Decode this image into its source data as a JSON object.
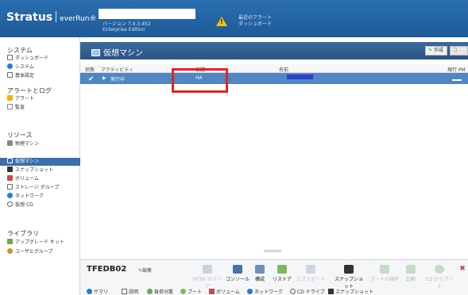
{
  "header": {
    "logo": "Stratus",
    "logo_sub": "everRun®",
    "version_line1": "バージョン 7.4.3-452",
    "version_line2": "Enterprise Edition",
    "alert_line1": "最近のアラート",
    "alert_line2": "ダッシュボード"
  },
  "sidebar": {
    "system_title": "システム",
    "system_items": [
      "ダッシュボード",
      "システム",
      "基本設定"
    ],
    "alerts_title": "アラートとログ",
    "alerts_items": [
      "アラート",
      "監査"
    ],
    "resources_title": "リソース",
    "resources_items": [
      "物理マシン",
      "仮想マシン",
      "スナップショット",
      "ボリューム",
      "ストレージ グループ",
      "ネットワーク",
      "仮想 CD"
    ],
    "library_title": "ライブラリ",
    "library_items": [
      "アップグレード キット",
      "ユーザとグループ"
    ]
  },
  "panel": {
    "title": "仮想マシン",
    "create_label": "作成",
    "other_label": "コ"
  },
  "table": {
    "headers": [
      "状態",
      "アクティビティ",
      "保護",
      "名前",
      "現行 PM"
    ],
    "row": {
      "activity": "実行中",
      "protection": "HA"
    }
  },
  "details": {
    "vm_name": "TFEDB02",
    "edit_label": "編集",
    "actions": [
      {
        "label": "MTBF のクリア",
        "enabled": false
      },
      {
        "label": "コンソール",
        "enabled": true
      },
      {
        "label": "構成",
        "enabled": true
      },
      {
        "label": "リストア",
        "enabled": true
      },
      {
        "label": "エクスポート",
        "enabled": false
      },
      {
        "label": "スナップショット",
        "enabled": true
      },
      {
        "label": "ブートの順序",
        "enabled": false
      },
      {
        "label": "起動",
        "enabled": false
      },
      {
        "label": "CD からブート",
        "enabled": false
      }
    ],
    "tabs": [
      "サマリ",
      "説明",
      "負荷分散",
      "ブート",
      "ボリューム",
      "ネットワーク",
      "CD ドライブ",
      "スナップショット"
    ]
  },
  "colors": {
    "header_bg": "#1d5a98",
    "selected_row": "#4f86c3",
    "highlight": "#e22424",
    "name_redaction": "#2d3fc9"
  }
}
